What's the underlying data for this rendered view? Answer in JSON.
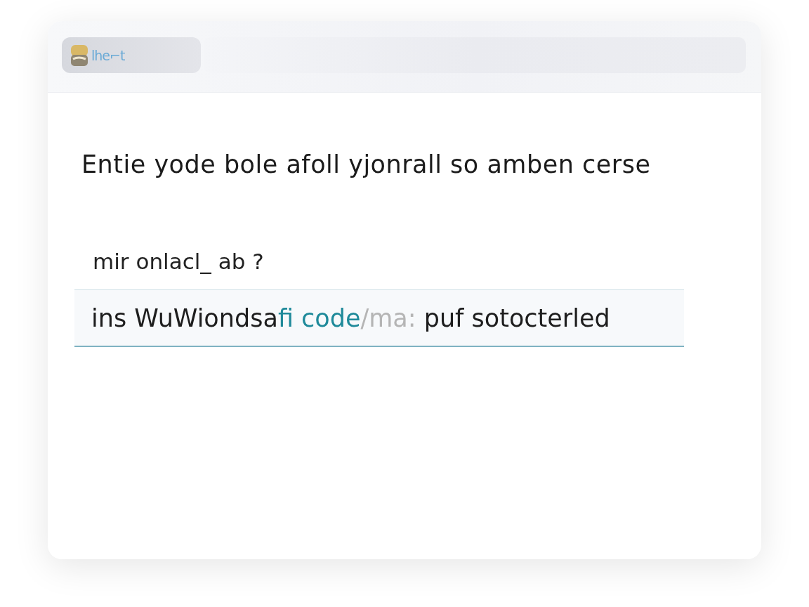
{
  "header": {
    "logo_text": "lhe⌐t"
  },
  "question": "Entie yode  bole afoll yjonrall so amben cerse",
  "field": {
    "label": "mir onlacl_ ab ?",
    "value": [
      {
        "text": "ins WuWiondsa",
        "kind": "normal"
      },
      {
        "text": "fi code",
        "kind": "accent"
      },
      {
        "text": "/ma:",
        "kind": "muted"
      },
      {
        "text": " puf sotocterled",
        "kind": "normal"
      }
    ]
  }
}
